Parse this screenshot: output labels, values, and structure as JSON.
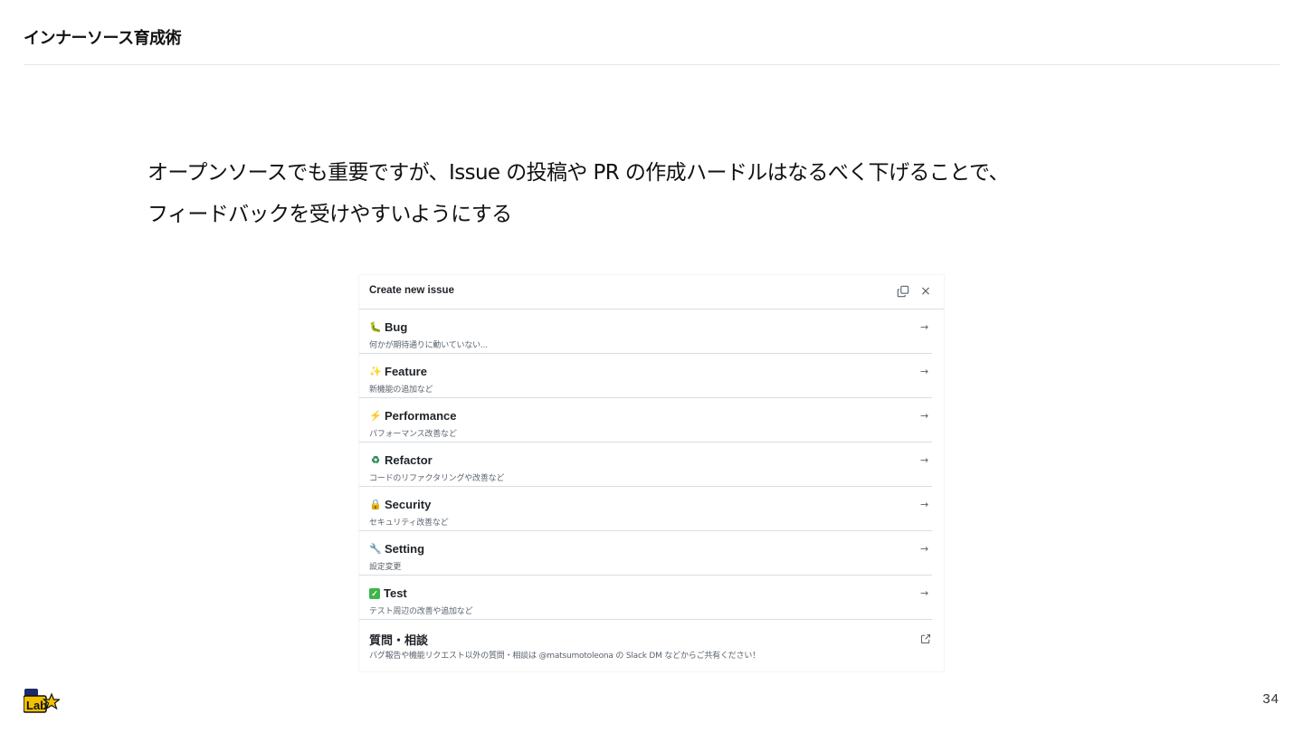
{
  "slide": {
    "header": "インナーソース育成術",
    "lead_line1": "オープンソースでも重要ですが、Issue の投稿や PR の作成ハードルはなるべく下げることで、",
    "lead_line2": "フィードバックを受けやすいようにする",
    "page_number": "34",
    "logo_text": "Lab"
  },
  "dialog": {
    "title": "Create new issue",
    "copy_icon": "copy-icon",
    "close_icon": "×",
    "arrow_glyph": "→",
    "items": [
      {
        "icon": "caterpillar-icon",
        "glyph": "🐛",
        "title": "Bug",
        "description": "何かが期待通りに動いていない..."
      },
      {
        "icon": "sparkles-icon",
        "glyph": "✨",
        "title": "Feature",
        "description": "新機能の追加など"
      },
      {
        "icon": "zap-icon",
        "glyph": "⚡",
        "title": "Performance",
        "description": "パフォーマンス改善など"
      },
      {
        "icon": "recycle-icon",
        "glyph": "♻",
        "title": "Refactor",
        "description": "コードのリファクタリングや改善など"
      },
      {
        "icon": "lock-icon",
        "glyph": "🔒",
        "title": "Security",
        "description": "セキュリティ改善など"
      },
      {
        "icon": "wrench-icon",
        "glyph": "🔧",
        "title": "Setting",
        "description": "設定変更"
      },
      {
        "icon": "check-icon",
        "glyph": "✓",
        "title": "Test",
        "description": "テスト周辺の改善や追加など"
      },
      {
        "icon": "external-link-icon",
        "title": "質問・相談",
        "description": "バグ報告や機能リクエスト以外の質問・相談は @matsumotoleona の Slack DM などからご共有ください！"
      }
    ]
  }
}
